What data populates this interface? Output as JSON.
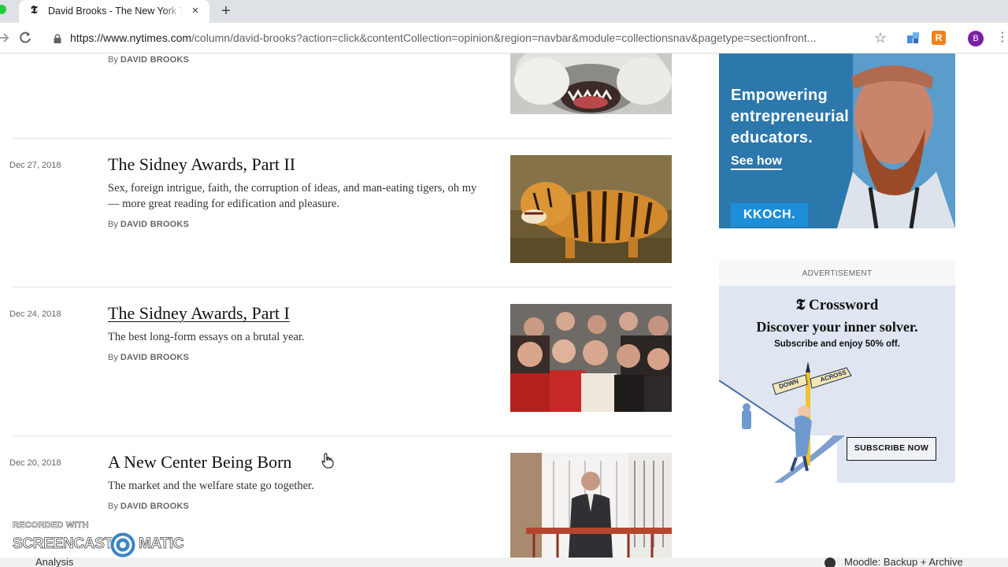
{
  "browser": {
    "tab_title": "David Brooks - The New York Times",
    "tab_favicon": "𝕿",
    "tab_close": "×",
    "new_tab": "+",
    "url_host": "https://www.nytimes.com",
    "url_path": "/column/david-brooks?action=click&contentCollection=opinion&region=navbar&module=collectionsnav&pagetype=sectionfront...",
    "avatar_letter": "B",
    "ext2_letter": "R",
    "icons": [
      "forward-icon",
      "reload-icon",
      "lock-icon",
      "star-icon",
      "extension-icon",
      "menu-icon"
    ]
  },
  "articles": [
    {
      "date": "",
      "title": "",
      "summary": "",
      "byline_prefix": "By",
      "author": "DAVID BROOKS",
      "image": "wolf"
    },
    {
      "date": "Dec 27, 2018",
      "title": "The Sidney Awards, Part II",
      "summary": "Sex, foreign intrigue, faith, the corruption of ideas, and man-eating tigers, oh my — more great reading for edification and pleasure.",
      "byline_prefix": "By",
      "author": "DAVID BROOKS",
      "image": "tiger"
    },
    {
      "date": "Dec 24, 2018",
      "title": "The Sidney Awards, Part I",
      "summary": "The best long-form essays on a brutal year.",
      "byline_prefix": "By",
      "author": "DAVID BROOKS",
      "image": "crowd"
    },
    {
      "date": "Dec 20, 2018",
      "title": "A New Center Being Born",
      "summary": "The market and the welfare state go together.",
      "byline_prefix": "By",
      "author": "DAVID BROOKS",
      "image": "man-in-suit"
    }
  ],
  "ads": {
    "koch": {
      "headline": "Empowering entrepreneurial educators.",
      "cta": "See how",
      "logo": "KKOCH."
    },
    "advertisement_label": "ADVERTISEMENT",
    "crossword": {
      "logo": "𝕿 Crossword",
      "headline": "Discover your inner solver.",
      "sub": "Subscribe and enjoy 50% off.",
      "sign_down": "DOWN",
      "sign_across": "ACROSS",
      "button": "SUBSCRIBE NOW"
    }
  },
  "watermark": {
    "recorded_with": "RECORDED WITH",
    "left": "SCREENCAST",
    "right": "MATIC"
  },
  "bottom_bar": {
    "left": "Analysis",
    "right": "Moodle: Backup + Archive"
  },
  "colors": {
    "koch_bg": "#2a7ab0",
    "crossword_bg": "#dfe6f2",
    "tab_strip": "#dee1e6"
  }
}
